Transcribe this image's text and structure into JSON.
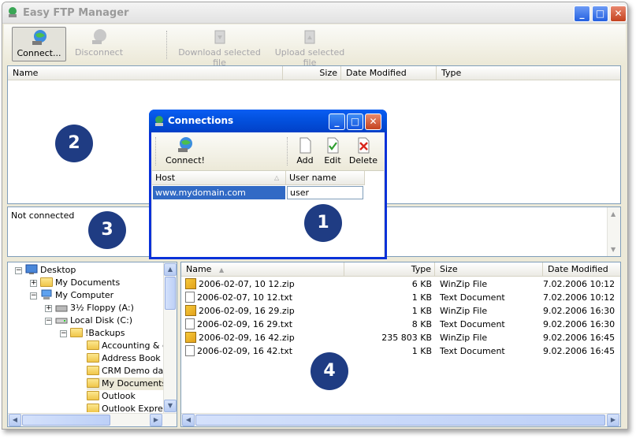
{
  "window": {
    "title": "Easy FTP Manager",
    "controls": {
      "minimize": "_",
      "maximize": "□",
      "close": "✕"
    }
  },
  "toolbar": {
    "connect_label": "Connect...",
    "disconnect_label": "Disconnect",
    "download_label": "Download selected file",
    "upload_label": "Upload selected file"
  },
  "remote": {
    "columns": {
      "name": "Name",
      "size": "Size",
      "date": "Date Modified",
      "type": "Type"
    }
  },
  "log": {
    "status": "Not connected"
  },
  "local_tree": {
    "items": [
      {
        "label": "Desktop",
        "expander": "−"
      },
      {
        "label": "My Documents",
        "expander": "+"
      },
      {
        "label": "My Computer",
        "expander": "−"
      },
      {
        "label": "3½ Floppy (A:)",
        "expander": "+"
      },
      {
        "label": "Local Disk (C:)",
        "expander": "−"
      },
      {
        "label": "!Backups",
        "expander": "−"
      },
      {
        "label": "Accounting & cu"
      },
      {
        "label": "Address Book &"
      },
      {
        "label": "CRM Demo data"
      },
      {
        "label": "My Documents ("
      },
      {
        "label": "Outlook"
      },
      {
        "label": "Outlook Express"
      }
    ]
  },
  "local_files": {
    "columns": {
      "name": "Name",
      "type": "Type",
      "size": "Size",
      "date": "Date Modified"
    },
    "rows": [
      {
        "name": "2006-02-07, 10 12.zip",
        "type": "6 KB",
        "size": "WinZip File",
        "date": "7.02.2006 10:12",
        "kind": "zip"
      },
      {
        "name": "2006-02-07, 10 12.txt",
        "type": "1 KB",
        "size": "Text Document",
        "date": "7.02.2006 10:12",
        "kind": "txt"
      },
      {
        "name": "2006-02-09, 16 29.zip",
        "type": "1 KB",
        "size": "WinZip File",
        "date": "9.02.2006 16:30",
        "kind": "zip"
      },
      {
        "name": "2006-02-09, 16 29.txt",
        "type": "8 KB",
        "size": "Text Document",
        "date": "9.02.2006 16:30",
        "kind": "txt"
      },
      {
        "name": "2006-02-09, 16 42.zip",
        "type": "235 803 KB",
        "size": "WinZip File",
        "date": "9.02.2006 16:45",
        "kind": "zip"
      },
      {
        "name": "2006-02-09, 16 42.txt",
        "type": "1 KB",
        "size": "Text Document",
        "date": "9.02.2006 16:45",
        "kind": "txt"
      }
    ]
  },
  "dialog": {
    "title": "Connections",
    "connect_label": "Connect!",
    "add_label": "Add",
    "edit_label": "Edit",
    "delete_label": "Delete",
    "columns": {
      "host": "Host",
      "user": "User name"
    },
    "rows": [
      {
        "host": "www.mydomain.com",
        "user": "user"
      }
    ]
  },
  "markers": [
    "1",
    "2",
    "3",
    "4"
  ],
  "colors": {
    "marker": "#1f3c83",
    "selection": "#316ac5",
    "xp_blue": "#0a5ef3"
  }
}
